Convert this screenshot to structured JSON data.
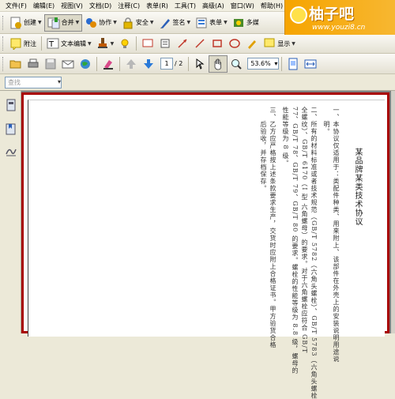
{
  "menu": [
    "文件(F)",
    "编辑(E)",
    "视图(V)",
    "文档(D)",
    "注释(C)",
    "表单(R)",
    "工具(T)",
    "高级(A)",
    "窗口(W)",
    "帮助(H)"
  ],
  "toolbar1": {
    "create": "创建",
    "combine": "合并",
    "collaborate": "协作",
    "secure": "安全",
    "sign": "签名",
    "forms": "表单",
    "multimedia": "多媒"
  },
  "toolbar2": {
    "attach": "附注",
    "text_edit": "文本编辑",
    "show": "显示"
  },
  "nav": {
    "page_current": "1",
    "page_total": "/ 2",
    "zoom": "53.6%"
  },
  "search": {
    "placeholder": "查找"
  },
  "document": {
    "title": "某品牌某类技术协议",
    "columns": [
      "一、本协议仅适用于：类配件种类、用来附上、该部件在外壳上的安装说明用途说",
      "　　明。",
      "二、所有的材料标准或者技术规范（GB/T 5782（六角头螺栓）、GB/T 5783（六角头螺栓",
      "全螺纹）、GB/T 6170（I 型  六角螺母）的要求。对于六角螺栓应符合 GB/T",
      "77、GB/T 78、GB/T 79、GB/T 80 的要求。螺栓的性能等级为 8.8 级，螺母的",
      "性能等级为 8 级。",
      "三、乙方应严格按上述条款要求生产，交货时应附上合格证书。甲方验货合格",
      "　　后验收，并存档保存。"
    ]
  },
  "logo": {
    "name": "柚子吧",
    "url": "www.youzi8.cn"
  },
  "colors": {
    "frame_red": "#a80000",
    "logo_orange": "#f6a400"
  }
}
